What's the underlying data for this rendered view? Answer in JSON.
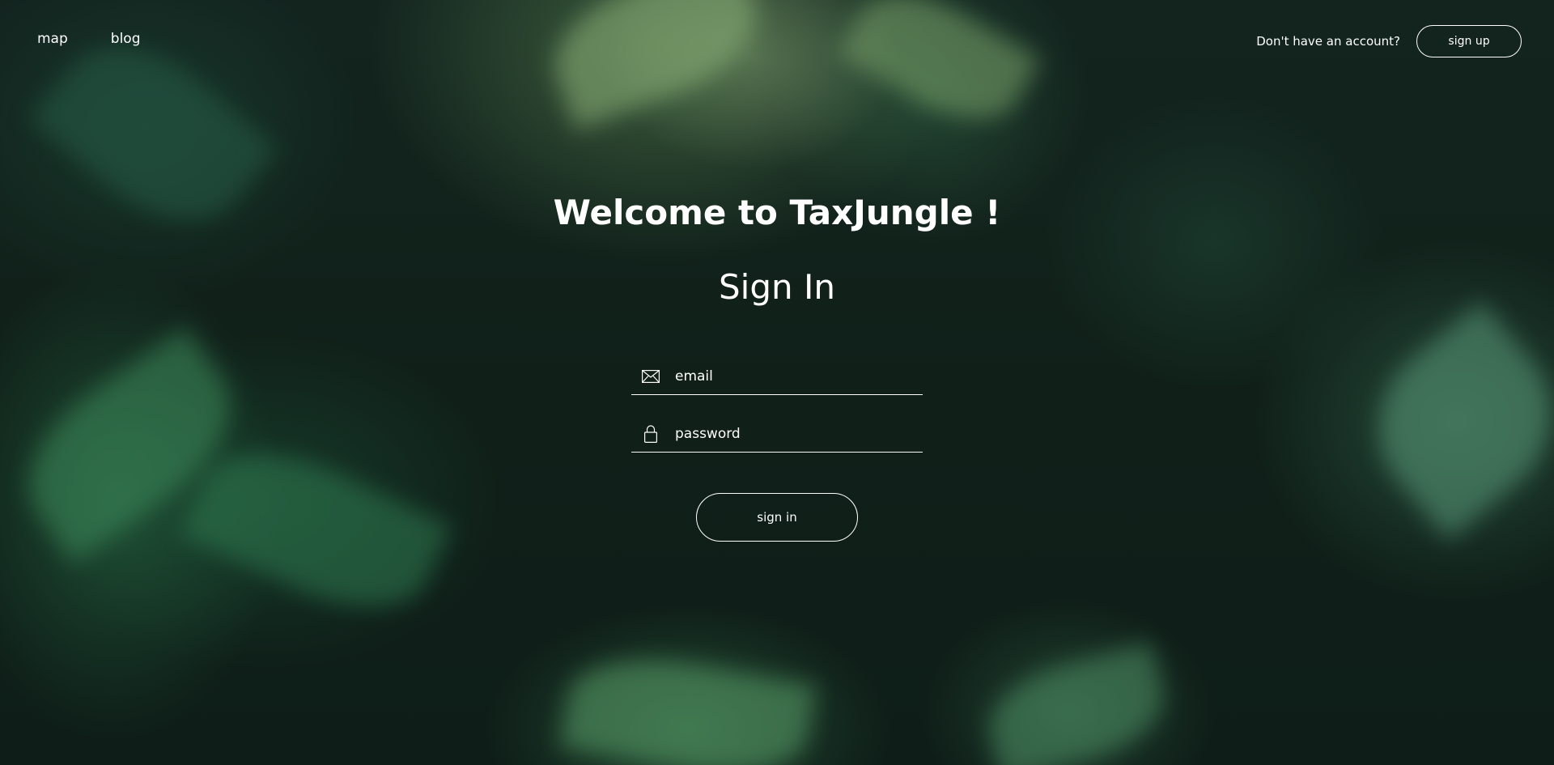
{
  "nav": {
    "links": [
      {
        "label": "map"
      },
      {
        "label": "blog"
      }
    ],
    "account_prompt": "Don't have an account?",
    "signup_label": "sign up"
  },
  "main": {
    "welcome": "Welcome to TaxJungle !",
    "title": "Sign In",
    "email_placeholder": "email",
    "password_placeholder": "password",
    "signin_label": "sign in"
  },
  "icons": {
    "email": "envelope-icon",
    "password": "lock-icon"
  },
  "colors": {
    "text": "#ffffff",
    "background": "#0f1e1a"
  }
}
